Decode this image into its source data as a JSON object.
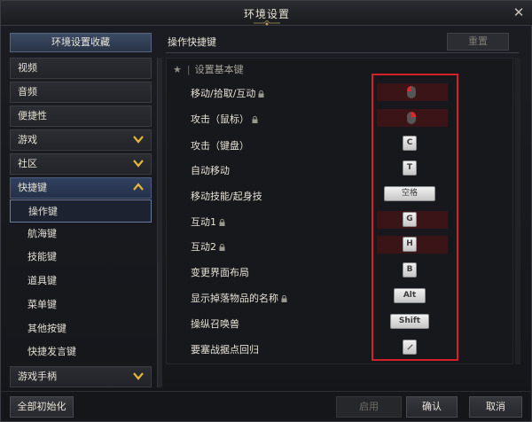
{
  "window": {
    "title": "环境设置"
  },
  "sidebar": {
    "header": "环境设置收藏",
    "items": [
      {
        "label": "视频",
        "chevron": false
      },
      {
        "label": "音频",
        "chevron": false
      },
      {
        "label": "便捷性",
        "chevron": false
      },
      {
        "label": "游戏",
        "chevron": true
      },
      {
        "label": "社区",
        "chevron": true
      },
      {
        "label": "快捷键",
        "chevron": true,
        "expanded": true
      }
    ],
    "subitems": [
      "操作键",
      "航海键",
      "技能键",
      "道具键",
      "菜单键",
      "其他按键",
      "快捷发言键"
    ],
    "active_subitem": "操作键",
    "last_item": {
      "label": "游戏手柄",
      "chevron": true
    }
  },
  "main": {
    "title": "操作快捷键",
    "reset_label": "重置",
    "section_title": "设置基本键",
    "rows": [
      {
        "label": "移动/拾取/互动",
        "locked": true,
        "key": "",
        "mouse": true
      },
      {
        "label": "攻击（鼠标）",
        "locked": true,
        "key": "",
        "mouse": true
      },
      {
        "label": "攻击（键盘）",
        "locked": false,
        "key": "C"
      },
      {
        "label": "自动移动",
        "locked": false,
        "key": "T"
      },
      {
        "label": "移动技能/起身技",
        "locked": false,
        "key": "空格"
      },
      {
        "label": "互动1",
        "locked": true,
        "key": "G"
      },
      {
        "label": "互动2",
        "locked": true,
        "key": "H"
      },
      {
        "label": "变更界面布局",
        "locked": false,
        "key": "B"
      },
      {
        "label": "显示掉落物品的名称",
        "locked": true,
        "key": "Alt"
      },
      {
        "label": "操纵召唤兽",
        "locked": false,
        "key": "Shift"
      },
      {
        "label": "要塞战据点回归",
        "locked": false,
        "key": "",
        "icon": "pencil-icon"
      }
    ]
  },
  "footer": {
    "reset_all": "全部初始化",
    "apply": "启用",
    "confirm": "确认",
    "cancel": "取消"
  },
  "colors": {
    "accent_chevron": "#e3b53b",
    "highlight_border": "#d51f2a",
    "mouse_cell": "#3a1416"
  }
}
